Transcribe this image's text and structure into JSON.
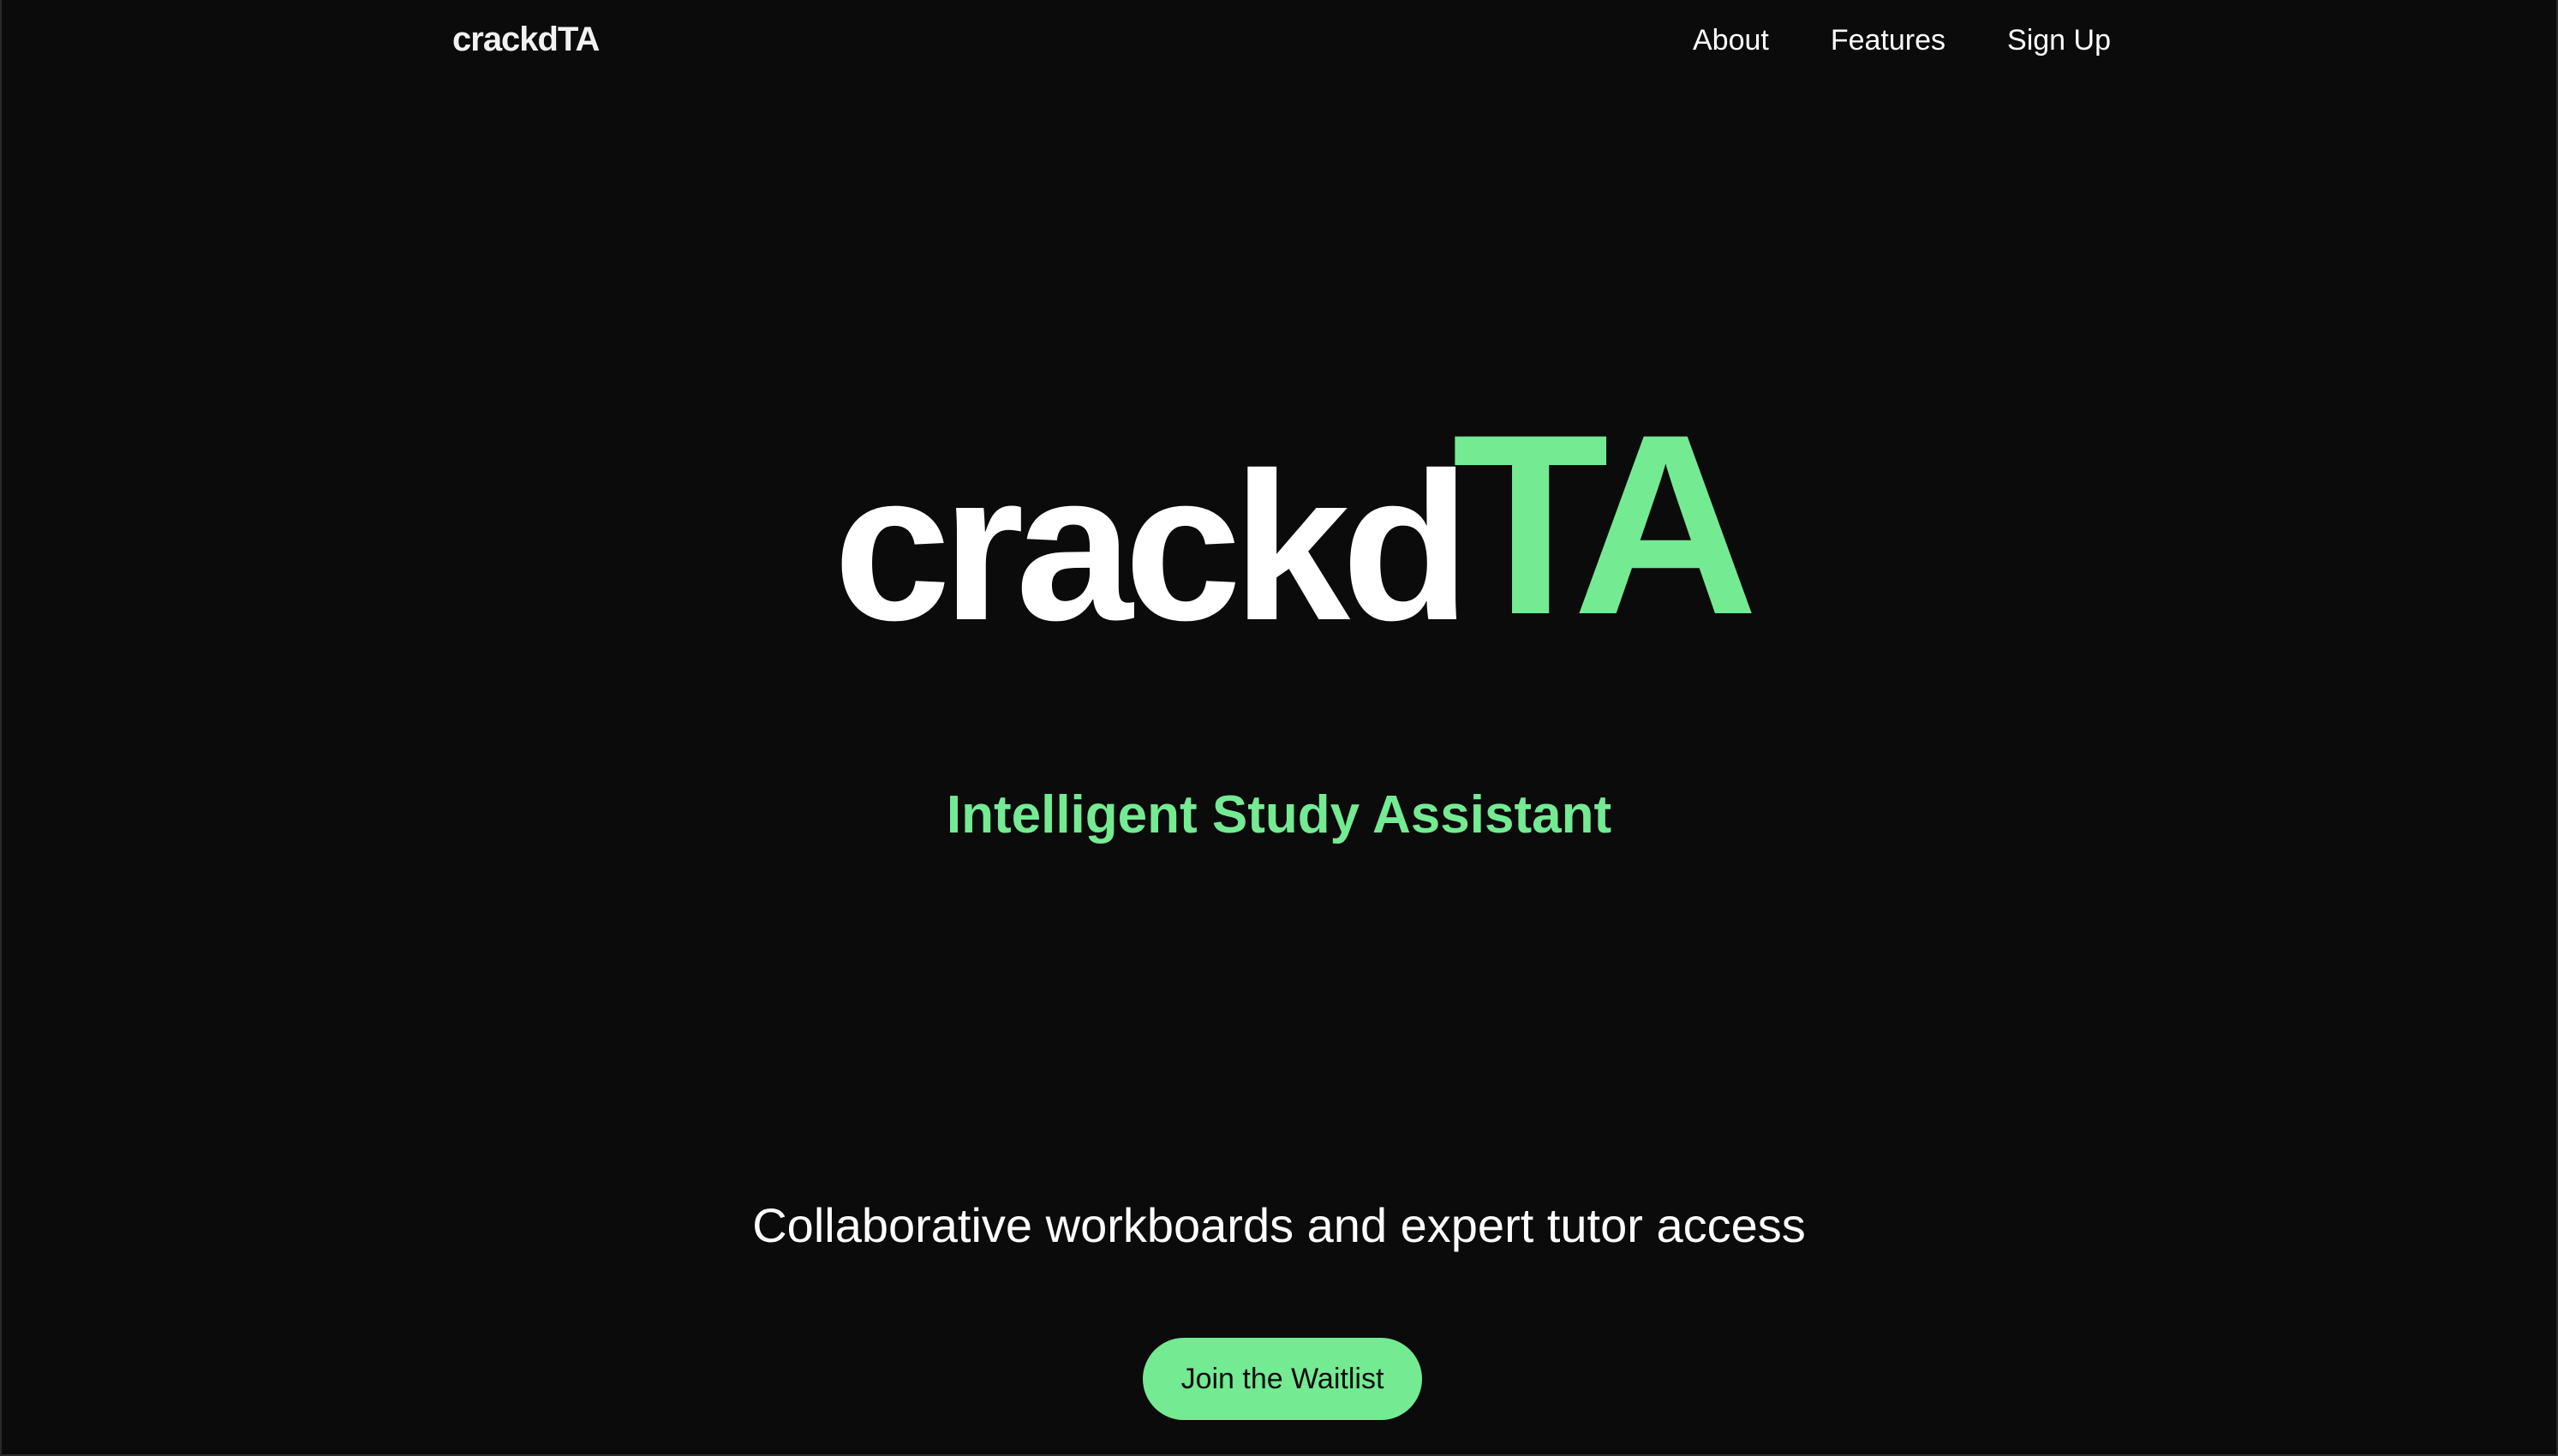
{
  "nav": {
    "brand": "crackdTA",
    "links": [
      {
        "label": "About"
      },
      {
        "label": "Features"
      },
      {
        "label": "Sign Up"
      }
    ]
  },
  "hero": {
    "logo_main": "crackd",
    "logo_accent": "TA",
    "subtitle": "Intelligent Study Assistant",
    "tagline": "Collaborative workboards and expert tutor access",
    "cta_label": "Join the Waitlist"
  },
  "colors": {
    "background": "#0b0b0b",
    "accent": "#74ea93",
    "text": "#ffffff"
  }
}
